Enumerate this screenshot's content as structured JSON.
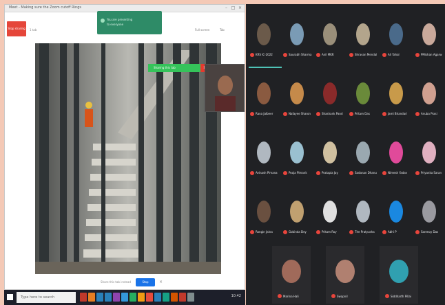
{
  "window": {
    "title": "Meet - Making sure the Zoom cutoff Rings",
    "minimize": "–",
    "maximize": "□",
    "close": "×"
  },
  "share": {
    "stop_label": "Stop sharing",
    "meta": "1 tab",
    "banner_line1": "You are presenting",
    "banner_line2": "to everyone",
    "tool1": "Full screen",
    "tool2": "Tab"
  },
  "presenter": {
    "bar_label": "Sharing this tab",
    "stop_label": "Stop"
  },
  "bottom_controls": {
    "label": "Share this tab instead",
    "button": "Stop",
    "close": "×"
  },
  "taskbar": {
    "search_placeholder": "Type here to search",
    "tray_time": "10:42",
    "app_colors": [
      "#c0392b",
      "#e67e22",
      "#2980b9",
      "#2980b9",
      "#8e44ad",
      "#3498db",
      "#27ae60",
      "#f39c12",
      "#e74c3c",
      "#2980b9",
      "#16a085",
      "#d35400",
      "#c0392b",
      "#7f8c8d"
    ]
  },
  "participants": [
    {
      "name": "KRS IC-2022",
      "color": "#6b5a4a"
    },
    {
      "name": "Saurabh Sharma",
      "color": "#7a9bb5"
    },
    {
      "name": "Anil MKR",
      "color": "#9a8f7a"
    },
    {
      "name": "Shravan Mendal",
      "color": "#b3a58c"
    },
    {
      "name": "Ali Yahal",
      "color": "#4a6a8a"
    },
    {
      "name": "PMishan Agarw",
      "color": "#c9a99b"
    },
    {
      "name": "Rana Jalbeer",
      "color": "#8a5a40"
    },
    {
      "name": "Nafayee Sharon",
      "color": "#c58a4a"
    },
    {
      "name": "Shashank Pand",
      "color": "#8a2a2a"
    },
    {
      "name": "Pritam Das",
      "color": "#6a8a3a"
    },
    {
      "name": "Jami Bhandari",
      "color": "#c89a4a"
    },
    {
      "name": "Anuba Prasi",
      "color": "#d0a090"
    },
    {
      "name": "Avinash Pimana",
      "color": "#b0b8c0"
    },
    {
      "name": "Pooja Pimank",
      "color": "#9ac0d0"
    },
    {
      "name": "Pratapia Jay",
      "color": "#d0c0a0"
    },
    {
      "name": "Sadanan Dhanu",
      "color": "#9aa8b0"
    },
    {
      "name": "Nimesh Yadav",
      "color": "#e04a9a"
    },
    {
      "name": "Priyanka Saran",
      "color": "#e0b0c0"
    },
    {
      "name": "Rongin Jaina",
      "color": "#6a5040"
    },
    {
      "name": "Gobinda Dey",
      "color": "#c0a070"
    },
    {
      "name": "Pritam Roy",
      "color": "#e0e0e0"
    },
    {
      "name": "The Pratyusha",
      "color": "#b0b8c0"
    },
    {
      "name": "Abhi P",
      "color": "#1a88e0"
    },
    {
      "name": "Sanmoy Das",
      "color": "#9a9aa0"
    }
  ],
  "bottom_participants": [
    {
      "name": "Marina Hali",
      "color": "#a06a5a"
    },
    {
      "name": "Swapnil",
      "color": "#b08070"
    },
    {
      "name": "Siddharth Pillai",
      "color": "#30a0b0"
    }
  ]
}
